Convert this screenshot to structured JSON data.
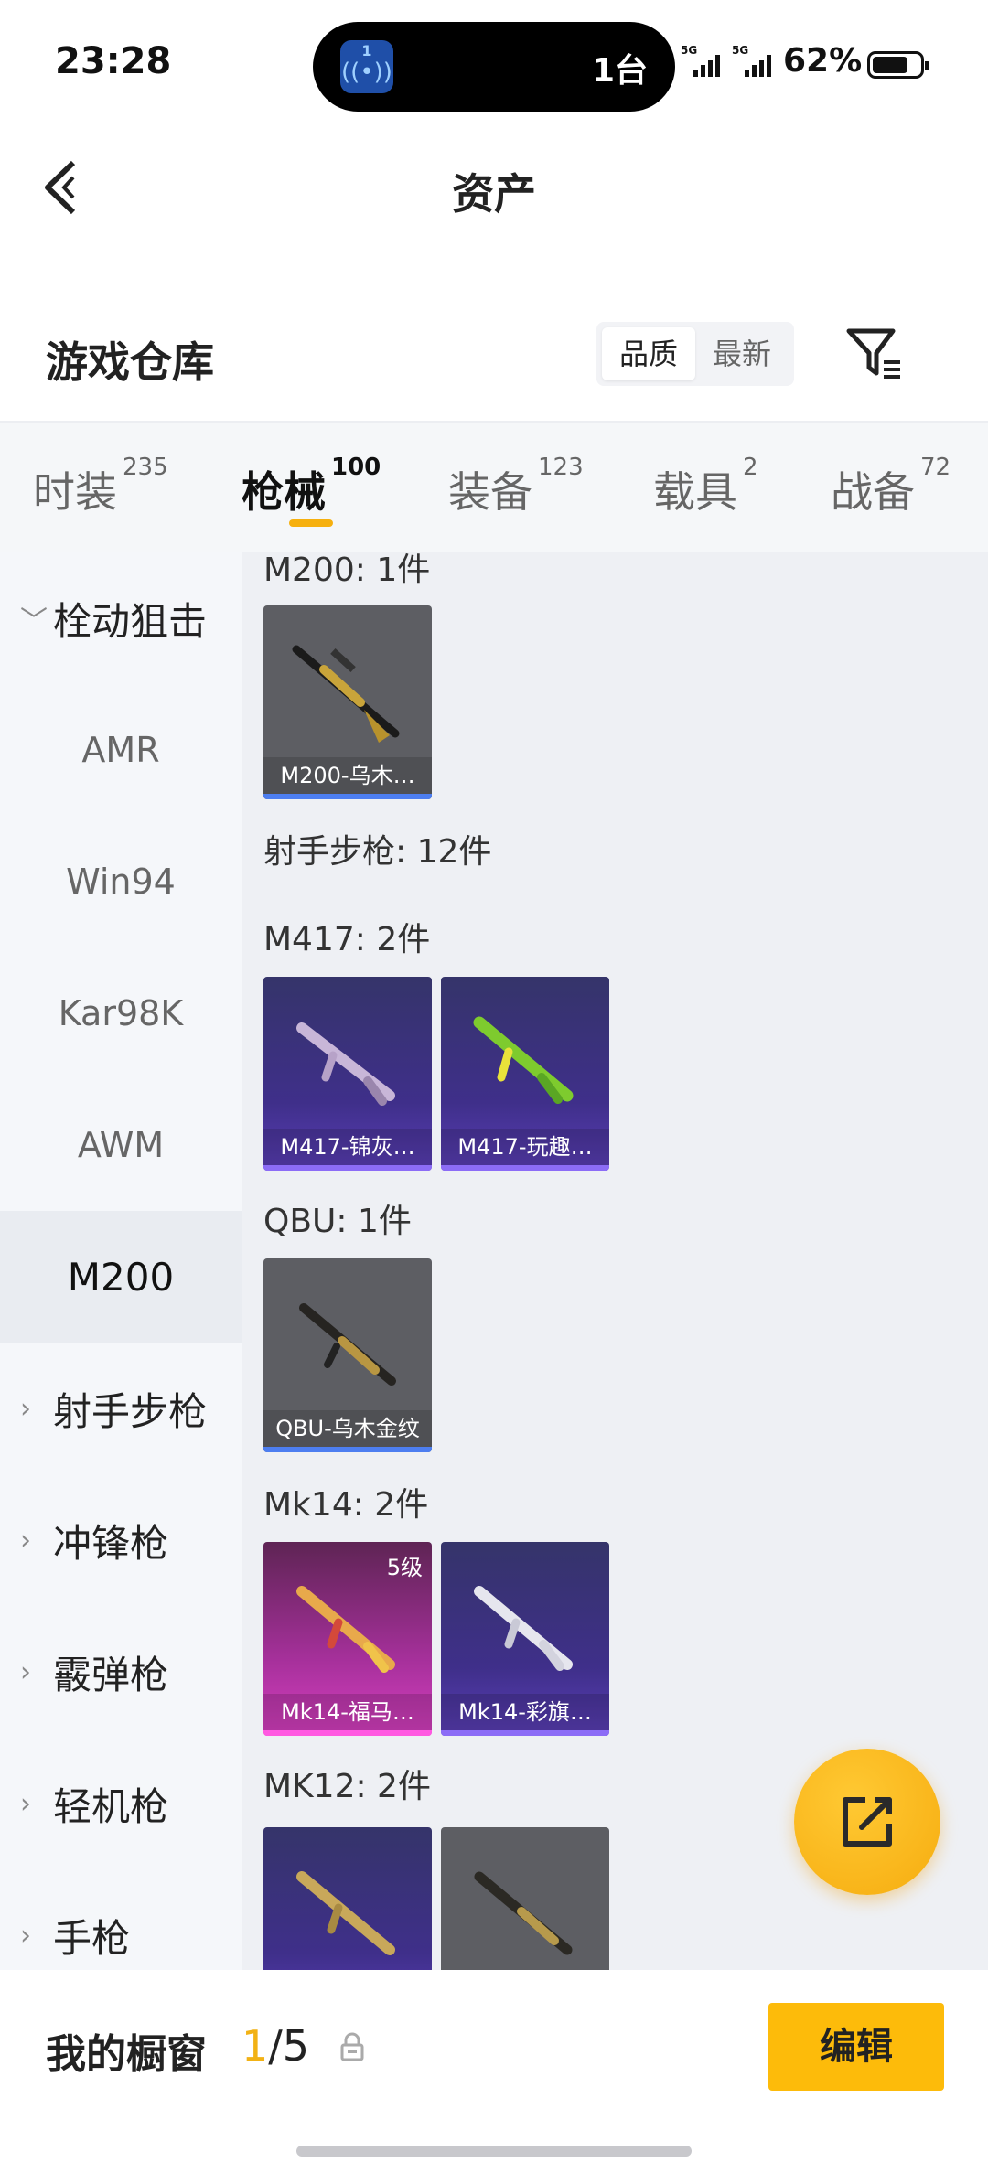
{
  "status_bar": {
    "time": "23:28",
    "island_badge": "1",
    "island_text": "1台",
    "sig1": "5G",
    "sig2": "5G",
    "battery": "62%"
  },
  "header": {
    "title": "资产"
  },
  "warehouse": {
    "title": "游戏仓库",
    "sort_options": [
      "品质",
      "最新"
    ],
    "sort_selected": "品质"
  },
  "tabs": [
    {
      "label": "时装",
      "count": "235"
    },
    {
      "label": "枪械",
      "count": "100",
      "active": true
    },
    {
      "label": "装备",
      "count": "123"
    },
    {
      "label": "载具",
      "count": "2"
    },
    {
      "label": "战备",
      "count": "72"
    }
  ],
  "sidebar": {
    "categories": [
      {
        "label": "栓动狙击",
        "expanded": true
      },
      {
        "label": "射手步枪"
      },
      {
        "label": "冲锋枪"
      },
      {
        "label": "霰弹枪"
      },
      {
        "label": "轻机枪"
      },
      {
        "label": "手枪"
      }
    ],
    "subitems": [
      "AMR",
      "Win94",
      "Kar98K",
      "AWM",
      "M200"
    ],
    "selected_subitem": "M200"
  },
  "content": {
    "groups": [
      {
        "title": "M200: 1件",
        "items": [
          {
            "name": "M200-乌木…",
            "rarity": "gray"
          }
        ]
      },
      {
        "title": "射手步枪: 12件",
        "items": []
      },
      {
        "title": "M417: 2件",
        "items": [
          {
            "name": "M417-锦灰…",
            "rarity": "purple"
          },
          {
            "name": "M417-玩趣…",
            "rarity": "purple"
          }
        ]
      },
      {
        "title": "QBU: 1件",
        "items": [
          {
            "name": "QBU-乌木金纹",
            "rarity": "gray"
          }
        ]
      },
      {
        "title": "Mk14: 2件",
        "items": [
          {
            "name": "Mk14-福马…",
            "rarity": "pink",
            "level": "5级"
          },
          {
            "name": "Mk14-彩旗…",
            "rarity": "purple"
          }
        ]
      },
      {
        "title": "MK12: 2件",
        "items": [
          {
            "name": "",
            "rarity": "purple"
          },
          {
            "name": "",
            "rarity": "gray"
          }
        ]
      }
    ]
  },
  "bottom_bar": {
    "title": "我的橱窗",
    "slots_current": "1",
    "slots_total": "/5",
    "edit_label": "编辑"
  },
  "colors": {
    "accent": "#fdbb0a",
    "tab_underline": "#f6b00f",
    "sidebar_bg": "#f5f7fa",
    "content_bg": "#eef0f4"
  }
}
